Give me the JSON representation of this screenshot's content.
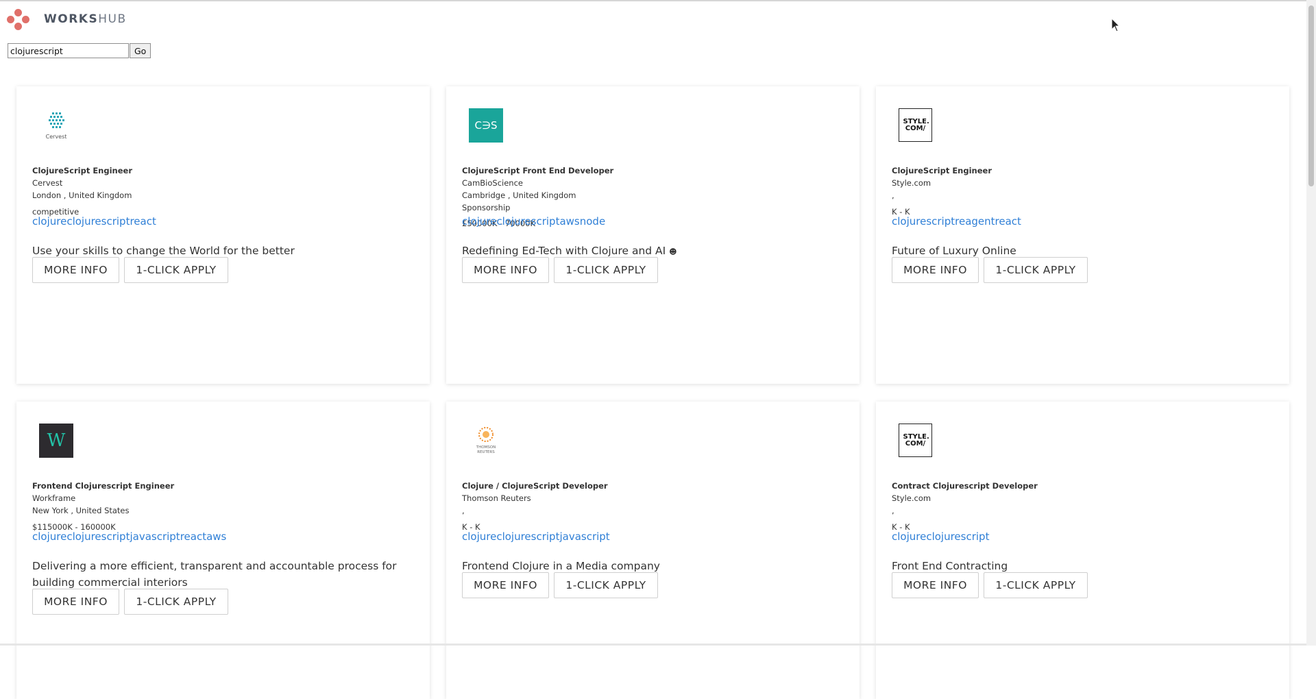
{
  "header": {
    "logo_bold": "WORKS",
    "logo_light": "HUB"
  },
  "search": {
    "value": "clojurescript",
    "go_label": "Go"
  },
  "jobs": [
    {
      "logo_icon": "cervest-logo",
      "logo_text": "Cervest",
      "title": "ClojureScript Engineer",
      "company": "Cervest",
      "location": "London , United Kingdom",
      "extra": "",
      "salary": "competitive",
      "tags": "clojureclojurescriptreact",
      "tagline": "Use your skills to change the World for the better",
      "more_label": "MORE INFO",
      "apply_label": "1-CLICK APPLY"
    },
    {
      "logo_icon": "cambioscience-logo",
      "logo_text": "C∋S",
      "title": "ClojureScript Front End Developer",
      "company": "CamBioScience",
      "location": "Cambridge , United Kingdom",
      "extra": "Sponsorship",
      "salary": "£50000K - 70000K",
      "tags": "clojureclojurescriptawsnode",
      "tagline": "Redefining Ed-Tech with Clojure and AI",
      "more_label": "MORE INFO",
      "apply_label": "1-CLICK APPLY"
    },
    {
      "logo_icon": "stylecom-logo",
      "logo_text": "STYLE. COM/",
      "title": "ClojureScript Engineer",
      "company": "Style.com",
      "location": ",",
      "extra": "",
      "salary": "K - K",
      "tags": "clojurescriptreagentreact",
      "tagline": "Future of Luxury Online",
      "more_label": "MORE INFO",
      "apply_label": "1-CLICK APPLY"
    },
    {
      "logo_icon": "workframe-logo",
      "logo_text": "W",
      "title": "Frontend Clojurescript Engineer",
      "company": "Workframe",
      "location": "New York , United States",
      "extra": "",
      "salary": "$115000K - 160000K",
      "tags": "clojureclojurescriptjavascriptreactaws",
      "tagline": "Delivering a more efficient, transparent and accountable process for building commercial interiors",
      "more_label": "MORE INFO",
      "apply_label": "1-CLICK APPLY"
    },
    {
      "logo_icon": "thomson-reuters-logo",
      "logo_text": "THOMSON REUTERS",
      "title": "Clojure / ClojureScript Developer",
      "company": "Thomson Reuters",
      "location": ",",
      "extra": "",
      "salary": "K - K",
      "tags": "clojureclojurescriptjavascript",
      "tagline": "Frontend Clojure in a Media company",
      "more_label": "MORE INFO",
      "apply_label": "1-CLICK APPLY"
    },
    {
      "logo_icon": "stylecom-logo",
      "logo_text": "STYLE. COM/",
      "title": "Contract Clojurescript Developer",
      "company": "Style.com",
      "location": ",",
      "extra": "",
      "salary": "K - K",
      "tags": "clojureclojurescript",
      "tagline": "Front End Contracting",
      "more_label": "MORE INFO",
      "apply_label": "1-CLICK APPLY"
    }
  ]
}
